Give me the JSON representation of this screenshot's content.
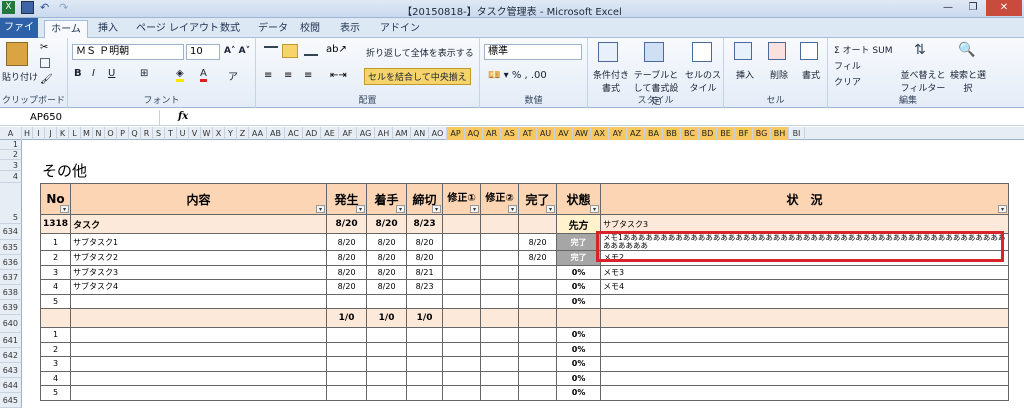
{
  "window": {
    "title": "【20150818-】タスク管理表 - Microsoft Excel"
  },
  "tabs": [
    "ファイル",
    "ホーム",
    "挿入",
    "ページ レイアウト",
    "数式",
    "データ",
    "校閲",
    "表示",
    "アドイン"
  ],
  "ribbon": {
    "clipboard": {
      "paste": "貼り付け",
      "label": "クリップボード"
    },
    "font": {
      "name": "ＭＳ Ｐ明朝",
      "size": "10",
      "label": "フォント"
    },
    "align": {
      "wrap": "折り返して全体を表示する",
      "merge": "セルを結合して中央揃え",
      "label": "配置"
    },
    "number": {
      "format": "標準",
      "label": "数値"
    },
    "styles": {
      "cond": "条件付き書式",
      "table": "テーブルとして書式設定",
      "cell": "セルのスタイル",
      "label": "スタイル"
    },
    "cells": {
      "insert": "挿入",
      "delete": "削除",
      "format": "書式",
      "label": "セル"
    },
    "edit": {
      "autosum": "Σ オート SUM",
      "fill": "フィル",
      "clear": "クリア",
      "sort": "並べ替えとフィルター",
      "find": "検索と選択",
      "label": "編集"
    }
  },
  "formula_bar": {
    "name_box": "AP650",
    "fx": "fx"
  },
  "columns": [
    "A",
    "H",
    "I",
    "J",
    "K",
    "L",
    "M",
    "N",
    "O",
    "P",
    "Q",
    "R",
    "S",
    "T",
    "U",
    "V",
    "W",
    "X",
    "Y",
    "Z",
    "AA",
    "AB",
    "AC",
    "AD",
    "AE",
    "AF",
    "AG",
    "AH",
    "AM",
    "AN",
    "AO",
    "AP",
    "AQ",
    "AR",
    "AS",
    "AT",
    "AU",
    "AV",
    "AW",
    "AX",
    "AY",
    "AZ",
    "BA",
    "BB",
    "BC",
    "BD",
    "BE",
    "BF",
    "BG",
    "BH",
    "BI"
  ],
  "rows": [
    "1",
    "2",
    "3",
    "4",
    "5",
    "634",
    "635",
    "636",
    "637",
    "638",
    "639",
    "640",
    "641",
    "642",
    "643",
    "644",
    "645"
  ],
  "sheet": {
    "heading": "その他",
    "headers": [
      "No",
      "内容",
      "発生",
      "着手",
      "締切",
      "修正①",
      "修正②",
      "完了",
      "状態",
      "状　況"
    ],
    "parent": {
      "no": "1318",
      "name": "タスク",
      "occur": "8/20",
      "start": "8/20",
      "due": "8/23",
      "state": "先方",
      "status": "サブタスク3"
    },
    "tasks": [
      {
        "no": "1",
        "name": "サブタスク1",
        "occur": "8/20",
        "start": "8/20",
        "due": "8/20",
        "done": "8/20",
        "state": "完了",
        "status": "メモ1あああああああああああああああああああああああああああああああああああああああああああああああああああああああああ"
      },
      {
        "no": "2",
        "name": "サブタスク2",
        "occur": "8/20",
        "start": "8/20",
        "due": "8/20",
        "done": "8/20",
        "state": "完了",
        "status": "メモ2"
      },
      {
        "no": "3",
        "name": "サブタスク3",
        "occur": "8/20",
        "start": "8/20",
        "due": "8/21",
        "done": "",
        "state": "0%",
        "status": "メモ3"
      },
      {
        "no": "4",
        "name": "サブタスク4",
        "occur": "8/20",
        "start": "8/20",
        "due": "8/23",
        "done": "",
        "state": "0%",
        "status": "メモ4"
      },
      {
        "no": "5",
        "name": "",
        "occur": "",
        "start": "",
        "due": "",
        "done": "",
        "state": "0%",
        "status": ""
      }
    ],
    "summary": {
      "occur": "1/0",
      "start": "1/0",
      "due": "1/0"
    },
    "empty_rows": [
      {
        "no": "1",
        "state": "0%"
      },
      {
        "no": "2",
        "state": "0%"
      },
      {
        "no": "3",
        "state": "0%"
      },
      {
        "no": "4",
        "state": "0%"
      },
      {
        "no": "5",
        "state": "0%"
      }
    ]
  }
}
